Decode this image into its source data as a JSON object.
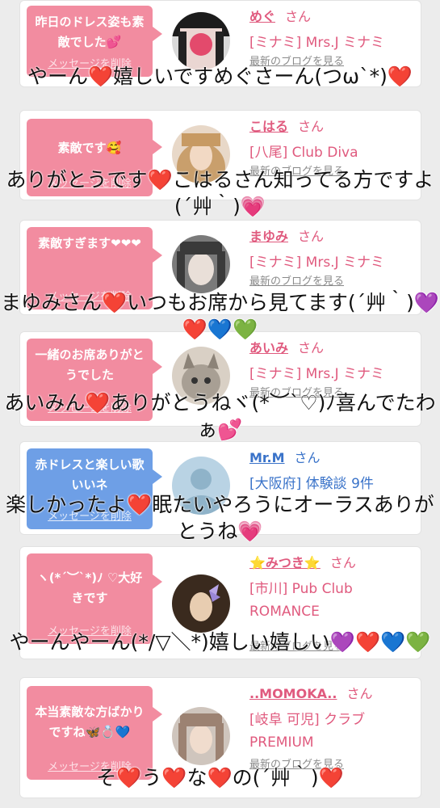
{
  "comments": [
    {
      "bubble": "昨日のドレス姿も素敵でした💕",
      "delete": "メッセージを削除",
      "name": "めぐ",
      "san": "さん",
      "shop": "[ミナミ] Mrs.J ミナミ",
      "blog": "最新のブログを見る",
      "reply": "やーん❤️嬉しいですめぐさーん(つω`*)❤️",
      "theme": "pink"
    },
    {
      "bubble": "素敵です🥰",
      "delete": "メッセージを削除",
      "name": "こはる",
      "san": "さん",
      "shop": "[八尾] Club Diva",
      "blog": "最新のブログを見る",
      "reply": "ありがとうです❤️こはるさん知ってる方ですよ(´艸｀)💗",
      "theme": "pink"
    },
    {
      "bubble": "素敵すぎます❤❤❤",
      "delete": "メッセージを削除",
      "name": "まゆみ",
      "san": "さん",
      "shop": "[ミナミ] Mrs.J ミナミ",
      "blog": "最新のブログを見る",
      "reply": "まゆみさん❤️いつもお席から見てます(´艸｀)💜❤️💙💚",
      "theme": "pink"
    },
    {
      "bubble": "一緒のお席ありがとうでした",
      "delete": "メッセージを削除",
      "name": "あいみ",
      "san": "さん",
      "shop": "[ミナミ] Mrs.J ミナミ",
      "blog": "最新のブログを見る",
      "reply": "あいみん❤️ありがとうねヾ(*︶`♡)ﾉ喜んでたわぁ💕",
      "theme": "pink"
    },
    {
      "bubble": "赤ドレスと楽しい歌いいネ",
      "delete": "メッセージを削除",
      "name": "Mr.M",
      "san": "さん",
      "shop": "[大阪府] 体験談 9件",
      "blog": "",
      "reply": "楽しかったよ❤️眠たいやろうにオーラスありがとうね💗",
      "theme": "blue"
    },
    {
      "bubble": "ヽ(*´︶`*)ﾉ ♡大好きです",
      "delete": "メッセージを削除",
      "name": "⭐みつき⭐",
      "san": "さん",
      "shop": "[市川] Pub Club ROMANCE",
      "blog": "最新のブログを見る",
      "reply": "やーんやーん(*/▽＼*)嬉しい嬉しい💜❤️💙💚",
      "theme": "pink"
    },
    {
      "bubble": "本当素敵な方ばかりですね🦋💍💙",
      "delete": "メッセージを削除",
      "name": "..MOMOKA..",
      "san": "さん",
      "shop": "[岐阜 可児] クラブ PREMIUM",
      "blog": "最新のブログを見る",
      "reply": "そ❤️う❤️な❤️の(´艸｀)❤️",
      "theme": "pink"
    }
  ],
  "colors": {
    "pink": "#f28ca0",
    "blue": "#6e9fe6",
    "name_pink": "#e05a7e",
    "name_blue": "#3a73c9"
  }
}
